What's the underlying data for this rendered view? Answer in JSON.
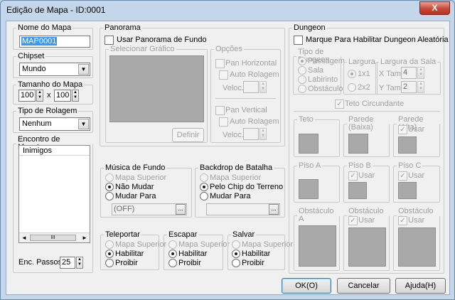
{
  "window": {
    "title": "Edição de Mapa - ID:0001",
    "close_glyph": "X"
  },
  "nome": {
    "legend": "Nome do Mapa",
    "value": "MAP0001"
  },
  "chipset": {
    "legend": "Chipset",
    "value": "Mundo"
  },
  "tamanho": {
    "legend": "Tamanho do Mapa",
    "width": "100",
    "x_label": "x",
    "height": "100"
  },
  "rolagem": {
    "legend": "Tipo de Rolagem",
    "value": "Nenhum"
  },
  "monstros": {
    "legend": "Encontro de Monstros",
    "column_header": "Inimigos",
    "hscroll_thumb": "III",
    "enc_label": "Enc. Passos",
    "enc_value": "25"
  },
  "panorama": {
    "legend": "Panorama",
    "usar": "Usar Panorama de Fundo",
    "sel_grafico": "Selecionar Gráfico",
    "definir": "Definir",
    "opcoes": "Opções",
    "pan_h": "Pan Horizontal",
    "auto_h": "Auto Rolagem",
    "veloc_h": "Veloc.:",
    "pan_v": "Pan Vertical",
    "auto_v": "Auto Rolagem",
    "veloc_v": "Veloc.:"
  },
  "musica": {
    "legend": "Música de Fundo",
    "opt1": "Mapa Superior",
    "opt2": "Não Mudar",
    "opt3": "Mudar Para",
    "value": "(OFF)",
    "browse": "..."
  },
  "backdrop": {
    "legend": "Backdrop de Batalha",
    "opt1": "Mapa Superior",
    "opt2": "Pelo Chip do Terreno",
    "opt3": "Mudar Para",
    "browse": "..."
  },
  "teleportar": {
    "legend": "Teleportar",
    "opt1": "Mapa Superior",
    "opt2": "Habilitar",
    "opt3": "Proibir"
  },
  "escapar": {
    "legend": "Escapar",
    "opt1": "Mapa Superior",
    "opt2": "Habilitar",
    "opt3": "Proibir"
  },
  "salvar": {
    "legend": "Salvar",
    "opt1": "Mapa Superior",
    "opt2": "Habilitar",
    "opt3": "Proibir"
  },
  "dungeon": {
    "legend": "Dungeon",
    "marque": "Marque Para Habilitar Dungeon Aleatória",
    "tipo": "Tipo de Dungeon",
    "tipo_opts": [
      "Passagem",
      "Sala",
      "Labirinto",
      "Obstáculo"
    ],
    "largura": "Largura",
    "largura_opts": [
      "1x1",
      "2x2"
    ],
    "largura_sala": "Largura da Sala",
    "xtam": "X Tam.",
    "xtam_val": "4",
    "ytam": "Y Tam.",
    "ytam_val": "2",
    "teto_circ": "Teto Circundante",
    "teto": "Teto",
    "parede_baixa": "Parede (Baixa)",
    "parede_alta": "Parede (Alta)",
    "piso_a": "Piso A",
    "piso_b": "Piso B",
    "piso_c": "Piso C",
    "obst_a": "Obstáculo A",
    "obst_b": "Obstáculo B",
    "obst_c": "Obstáculo C",
    "usar": "Usar"
  },
  "buttons": {
    "ok": "OK(O)",
    "cancelar": "Cancelar",
    "ajuda": "Ajuda(H)"
  }
}
